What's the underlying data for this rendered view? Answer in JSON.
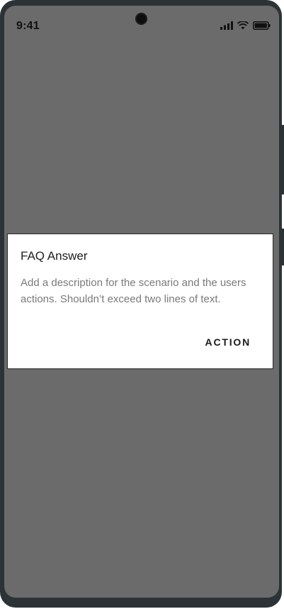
{
  "status_bar": {
    "time": "9:41",
    "icons": [
      "signal-icon",
      "wifi-icon",
      "battery-icon"
    ]
  },
  "dialog": {
    "title": "FAQ Answer",
    "body": "Add a description for the scenario and the users actions. Shouldn’t exceed two lines of text.",
    "action_label": "ACTION"
  },
  "colors": {
    "frame": "#2c3336",
    "scrim": "#6b6b6b",
    "dialog_bg": "#ffffff",
    "title_text": "#1f1f1f",
    "body_text": "#7a7a7a"
  }
}
